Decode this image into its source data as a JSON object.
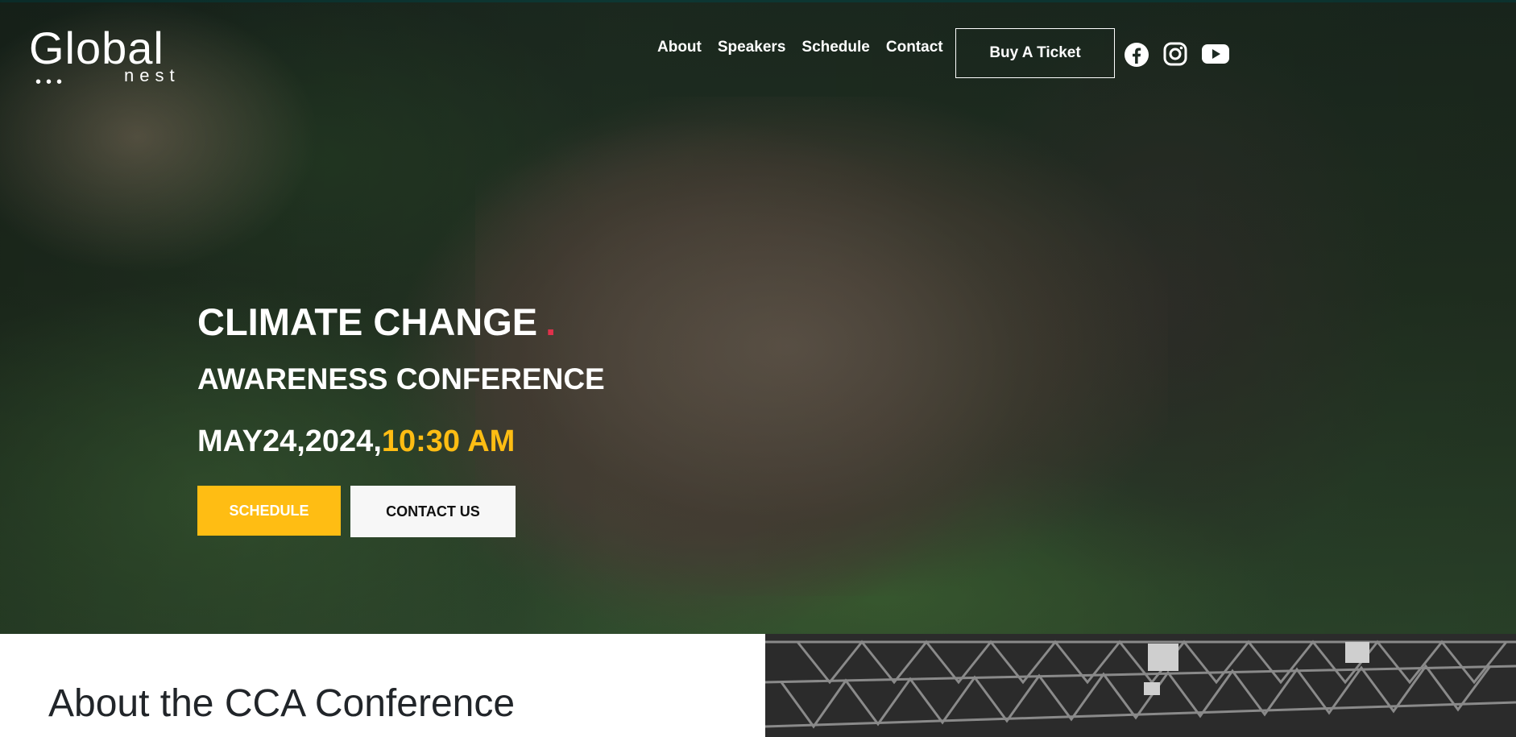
{
  "brand": {
    "logo_main": "Global",
    "logo_sub": "nest",
    "logo_dots": "•••"
  },
  "nav": {
    "items": [
      "About",
      "Speakers",
      "Schedule",
      "Contact"
    ],
    "ticket_label": "Buy A Ticket"
  },
  "social": [
    "facebook-icon",
    "instagram-icon",
    "youtube-icon"
  ],
  "hero": {
    "title_line1": "CLIMATE CHANGE",
    "title_dot": ".",
    "title_line2": "AWARENESS CONFERENCE",
    "date": "MAY24,2024,",
    "time": "10:30 AM",
    "schedule_button": "SCHEDULE",
    "contact_button": "CONTACT US"
  },
  "about": {
    "title": "About the CCA Conference"
  },
  "colors": {
    "accent": "#ffbd13",
    "dot": "#e0314b",
    "text_dark": "#212529"
  }
}
